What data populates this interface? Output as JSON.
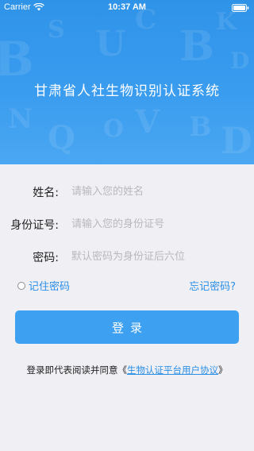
{
  "status_bar": {
    "carrier": "Carrier",
    "time": "10:37 AM"
  },
  "header": {
    "title": "甘肃省人社生物识别认证系统",
    "background_color": "#3a9cef"
  },
  "form": {
    "name": {
      "label": "姓名:",
      "placeholder": "请输入您的姓名",
      "value": ""
    },
    "id_number": {
      "label": "身份证号:",
      "placeholder": "请输入您的身份证号",
      "value": ""
    },
    "password": {
      "label": "密码:",
      "placeholder": "默认密码为身份证后六位",
      "value": ""
    }
  },
  "remember_password": {
    "label": "记住密码",
    "checked": false
  },
  "forgot_password": {
    "label": "忘记密码?"
  },
  "login_button": {
    "label": "登录",
    "color": "#3ea0f0"
  },
  "agreement": {
    "prefix": "登录即代表阅读并同意《",
    "link_text": "生物认证平台用户协议",
    "suffix": "》",
    "link_color": "#2a8fe6"
  },
  "icons": {
    "wifi": "wifi-icon",
    "battery": "battery-icon",
    "radio": "radio-unchecked-icon"
  }
}
